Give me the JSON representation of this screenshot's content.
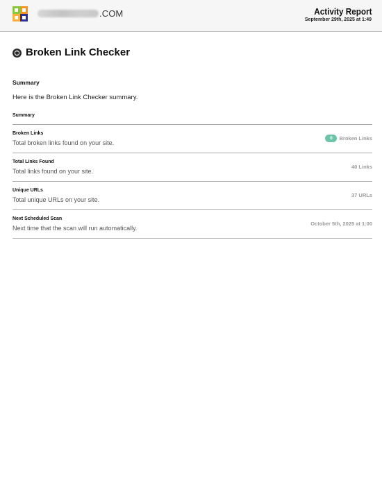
{
  "header": {
    "domain_suffix": ".COM",
    "report_title": "Activity Report",
    "report_date": "September 29th, 2025 at 1:49"
  },
  "section": {
    "title": "Broken Link Checker",
    "icon": "broken-link-icon"
  },
  "summary": {
    "heading": "Summary",
    "text": "Here is the Broken Link Checker summary.",
    "table_header": "Summary"
  },
  "rows": [
    {
      "label": "Broken Links",
      "description": "Total broken links found on your site.",
      "badge": "0",
      "value": "Broken Links"
    },
    {
      "label": "Total Links Found",
      "description": "Total links found on your site.",
      "value": "40 Links"
    },
    {
      "label": "Unique URLs",
      "description": "Total unique URLs on your site.",
      "value": "37 URLs"
    },
    {
      "label": "Next Scheduled Scan",
      "description": "Next time that the scan will run automatically.",
      "value": "October 5th, 2025 at 1:00"
    }
  ],
  "colors": {
    "badge": "#6ec4a7",
    "header_bg": "#f6f6f6",
    "muted_value": "#9a9a9a",
    "divider": "#a9a9a9"
  }
}
